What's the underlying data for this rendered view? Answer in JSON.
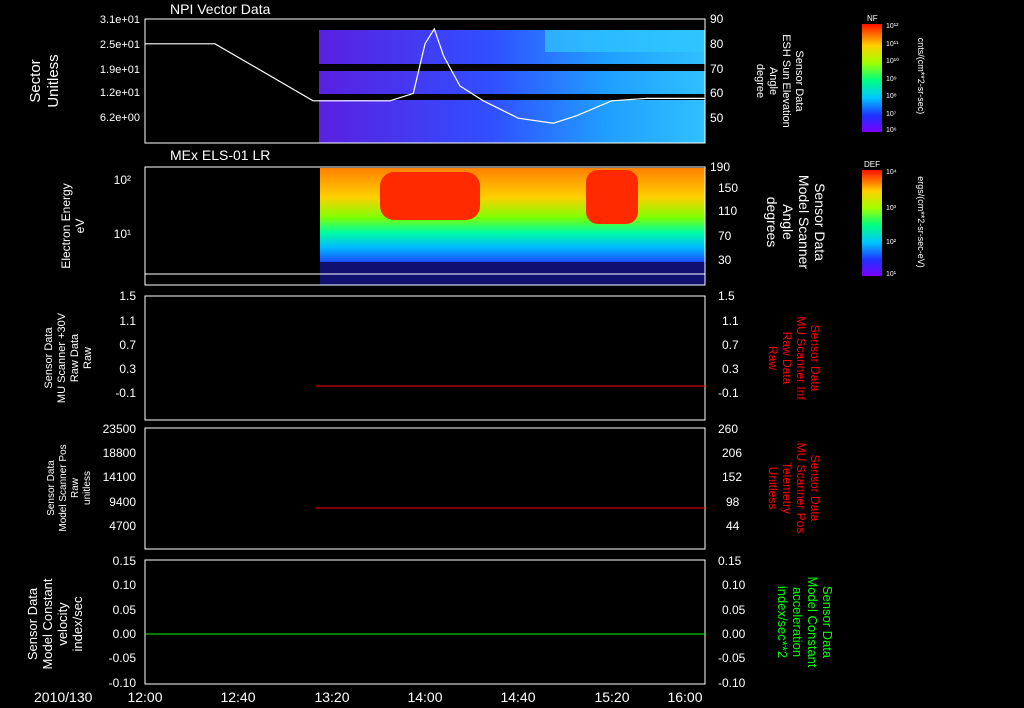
{
  "colors": {
    "background": "#000000",
    "axis": "#ffffff",
    "trace_white": "#ffffff",
    "trace_red": "#ff0000",
    "trace_green": "#00ff00"
  },
  "time_axis": {
    "date_label": "2010/130",
    "tick_labels": [
      "12:00",
      "12:40",
      "13:20",
      "14:00",
      "14:40",
      "15:20",
      "16:00"
    ],
    "range": [
      "12:00",
      "16:00"
    ]
  },
  "chart_data": [
    {
      "type": "heatmap",
      "title": "NPI Vector Data",
      "left_axis": {
        "label_lines": [
          "Sector",
          "Unitless"
        ],
        "tick_labels": [
          "3.1e+01",
          "2.5e+01",
          "1.9e+01",
          "1.2e+01",
          "6.2e+00"
        ]
      },
      "right_axis": {
        "label_lines": [
          "Sensor Data",
          "ESH Sun Elevation",
          "Angle",
          "degree"
        ],
        "tick_labels": [
          "90",
          "80",
          "70",
          "60",
          "50"
        ],
        "ylim": [
          40,
          90
        ]
      },
      "overlay_line": {
        "color": "#ffffff",
        "x": [
          "12:00",
          "12:30",
          "13:12",
          "13:45",
          "13:55",
          "14:00",
          "14:04",
          "14:08",
          "14:15",
          "14:25",
          "14:40",
          "14:55",
          "15:05",
          "15:20",
          "15:35",
          "16:00"
        ],
        "y": [
          80,
          80,
          57,
          57,
          60,
          80,
          86,
          75,
          63,
          57,
          50,
          48,
          51,
          57,
          58,
          58
        ]
      },
      "spectrogram_range": [
        "13:15",
        "16:00"
      ],
      "colorbar": {
        "label": "NF",
        "units": "cnts/(cm**2-sr-sec)",
        "tick_labels": [
          "10¹²",
          "10¹¹",
          "10¹⁰",
          "10⁹",
          "10⁸",
          "10⁷",
          "10⁶"
        ]
      }
    },
    {
      "type": "heatmap",
      "title": "MEx ELS-01 LR",
      "left_axis": {
        "label_lines": [
          "Electron Energy",
          "eV"
        ],
        "tick_labels": [
          "10²",
          "10¹"
        ]
      },
      "right_axis": {
        "label_lines": [
          "Sensor Data",
          "Model Scanner",
          "Angle",
          "degrees"
        ],
        "tick_labels": [
          "190",
          "150",
          "110",
          "70",
          "30"
        ],
        "ylim": [
          0,
          190
        ]
      },
      "spectrogram_range": [
        "13:15",
        "16:00"
      ],
      "colorbar": {
        "label": "DEF",
        "units": "ergs/(cm**2-sr-sec-eV)",
        "tick_labels": [
          "10⁴",
          "10³",
          "10²",
          "10¹"
        ]
      }
    },
    {
      "type": "line",
      "left_axis": {
        "label_lines": [
          "Sensor Data",
          "MU Scanner +30V",
          "Raw Data",
          "Raw"
        ],
        "tick_labels": [
          "1.5",
          "1.1",
          "0.7",
          "0.3",
          "-0.1"
        ],
        "ylim": [
          -0.5,
          1.5
        ]
      },
      "right_axis": {
        "label_lines": [
          "Sensor Data",
          "MU Scanner Inf",
          "Raw Data",
          "Raw"
        ],
        "tick_labels": [
          "1.5",
          "1.1",
          "0.7",
          "0.3",
          "-0.1"
        ],
        "color": "#ff0000"
      },
      "series": [
        {
          "color": "#ff0000",
          "x": [
            "13:15",
            "16:00"
          ],
          "y": [
            0.0,
            0.0
          ]
        }
      ]
    },
    {
      "type": "line",
      "left_axis": {
        "label_lines": [
          "Sensor Data",
          "Model Scanner Pos",
          "Raw",
          "unitless"
        ],
        "tick_labels": [
          "23500",
          "18800",
          "14100",
          "9400",
          "4700"
        ],
        "ylim": [
          0,
          23500
        ]
      },
      "right_axis": {
        "label_lines": [
          "Sensor Data",
          "MU Scanner Pos",
          "Telemetry",
          "Unitless"
        ],
        "tick_labels": [
          "260",
          "206",
          "152",
          "98",
          "44"
        ],
        "color": "#ff0000"
      },
      "series": [
        {
          "color": "#ff0000",
          "x": [
            "13:15",
            "16:00"
          ],
          "y": [
            8300,
            8300
          ]
        }
      ]
    },
    {
      "type": "line",
      "left_axis": {
        "label_lines": [
          "Sensor Data",
          "Model Constant",
          "velocity",
          "index/sec"
        ],
        "tick_labels": [
          "0.15",
          "0.10",
          "0.05",
          "0.00",
          "-0.05",
          "-0.10"
        ],
        "ylim": [
          -0.1,
          0.15
        ]
      },
      "right_axis": {
        "label_lines": [
          "Sensor Data",
          "Model Constant",
          "acceleration",
          "index/sec**2"
        ],
        "tick_labels": [
          "0.15",
          "0.10",
          "0.05",
          "0.00",
          "-0.05",
          "-0.10"
        ],
        "color": "#00ff00"
      },
      "series": [
        {
          "color": "#00ff00",
          "x": [
            "12:00",
            "16:00"
          ],
          "y": [
            0.0,
            0.0
          ]
        }
      ]
    }
  ]
}
